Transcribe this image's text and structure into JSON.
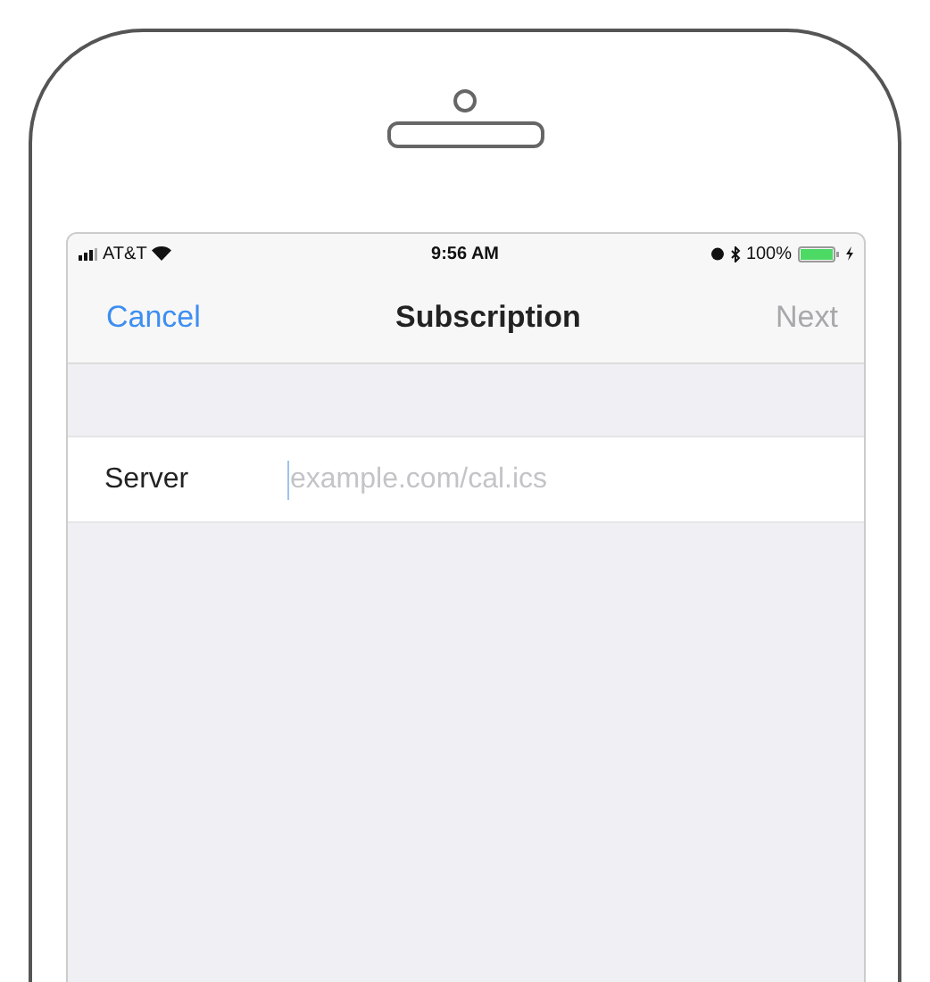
{
  "status_bar": {
    "carrier": "AT&T",
    "time": "9:56 AM",
    "battery": "100%"
  },
  "nav": {
    "cancel": "Cancel",
    "title": "Subscription",
    "next": {
      "label": "Next",
      "disabled": true
    }
  },
  "form": {
    "rows": [
      {
        "label": "Server",
        "placeholder": "example.com/cal.ics"
      }
    ]
  }
}
